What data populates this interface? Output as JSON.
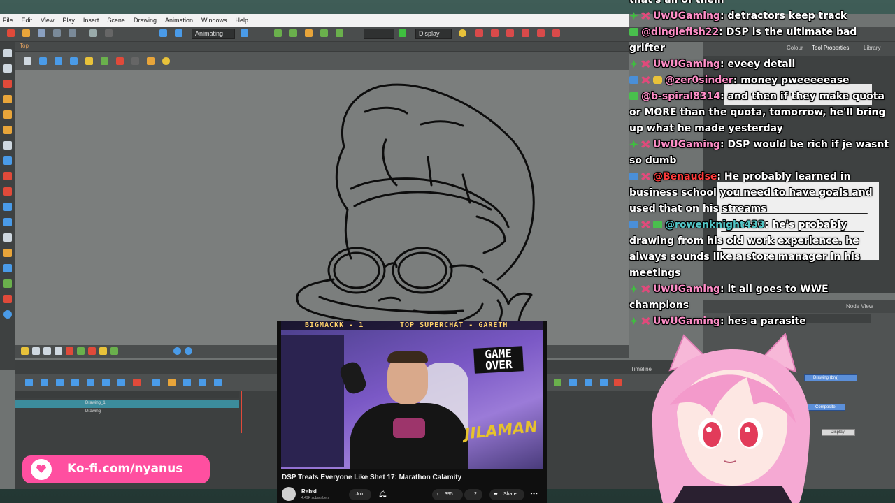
{
  "menu": {
    "items": [
      "File",
      "Edit",
      "View",
      "Play",
      "Insert",
      "Scene",
      "Drawing",
      "Animation",
      "Windows",
      "Help"
    ]
  },
  "toolbar": {
    "mode_select": "Animating",
    "display_select": "Display"
  },
  "camera_view": {
    "tab": "Top"
  },
  "right_panel": {
    "tabs": [
      "Colour",
      "Tool Properties",
      "Library"
    ]
  },
  "timeline": {
    "label": "Timeline",
    "layers": [
      "Drawing_1",
      "Drawing"
    ]
  },
  "node_view": {
    "tab": "Node View",
    "nodes": [
      "Drawing (brg)",
      "Composite",
      "Display"
    ]
  },
  "chat": {
    "messages": [
      {
        "user": "",
        "text": "that's all of them",
        "badges": []
      },
      {
        "user": "UwUGaming",
        "text": ": detractors keep track",
        "badges": [
          "green",
          "x"
        ]
      },
      {
        "user": "@dinglefish22",
        "text": ": DSP is the ultimate bad",
        "badges": [
          "sub"
        ]
      },
      {
        "user": "",
        "text": "grifter",
        "badges": []
      },
      {
        "user": "UwUGaming",
        "text": ": eveey detail",
        "badges": [
          "green",
          "x"
        ]
      },
      {
        "user": "@zer0sinder",
        "text": ": money pweeeeease",
        "badges": [
          "wrench",
          "x",
          "gold"
        ]
      },
      {
        "user": "@b-spiral8314",
        "text": ": and then if they make quota",
        "badges": [
          "sub"
        ]
      },
      {
        "user": "",
        "text": "or MORE than the quota, tomorrow, he'll bring",
        "badges": []
      },
      {
        "user": "",
        "text": "up what he made yesterday",
        "badges": []
      },
      {
        "user": "UwUGaming",
        "text": ": DSP would be rich if je wasnt",
        "badges": [
          "green",
          "x"
        ]
      },
      {
        "user": "",
        "text": "so dumb",
        "badges": []
      },
      {
        "user": "@Benaudse",
        "text": ": He probably learned in",
        "badges": [
          "wrench",
          "x"
        ]
      },
      {
        "user": "",
        "text": "business school you need to have goals and",
        "badges": []
      },
      {
        "user": "",
        "text": "used that on his streams",
        "badges": []
      },
      {
        "user": "@rowenknight433",
        "text": ": he's probably",
        "badges": [
          "wrench",
          "x",
          "sub"
        ]
      },
      {
        "user": "",
        "text": "drawing from his old work experience. he",
        "badges": []
      },
      {
        "user": "",
        "text": "always sounds like a store manager in his",
        "badges": []
      },
      {
        "user": "",
        "text": "meetings",
        "badges": []
      },
      {
        "user": "UwUGaming",
        "text": ": it all goes to WWE",
        "badges": [
          "green",
          "x"
        ]
      },
      {
        "user": "",
        "text": "champions",
        "badges": []
      },
      {
        "user": "UwUGaming",
        "text": ": hes a parasite",
        "badges": [
          "green",
          "x"
        ]
      }
    ]
  },
  "video": {
    "top_left": "BIGMACKK - 1",
    "top_right": "TOP SUPERCHAT - GARETH",
    "game_over": [
      "GAME",
      "OVER"
    ],
    "plant_text": "JILAMAN",
    "title": "DSP Treats Everyone Like Shet 17: Marathon Calamity",
    "channel": "Rebsi",
    "subs": "4.49K subscribers",
    "join": "Join",
    "likes": "395",
    "dislikes": "2",
    "share": "Share"
  },
  "kofi": {
    "text": "Ko-fi.com/nyanus"
  },
  "colors": {
    "accent_pink": "#ff4fa0",
    "chat_user": "#ff8fc8",
    "toolbar_bg": "#4a4d4d",
    "canvas_bg": "#7b7e7d"
  }
}
